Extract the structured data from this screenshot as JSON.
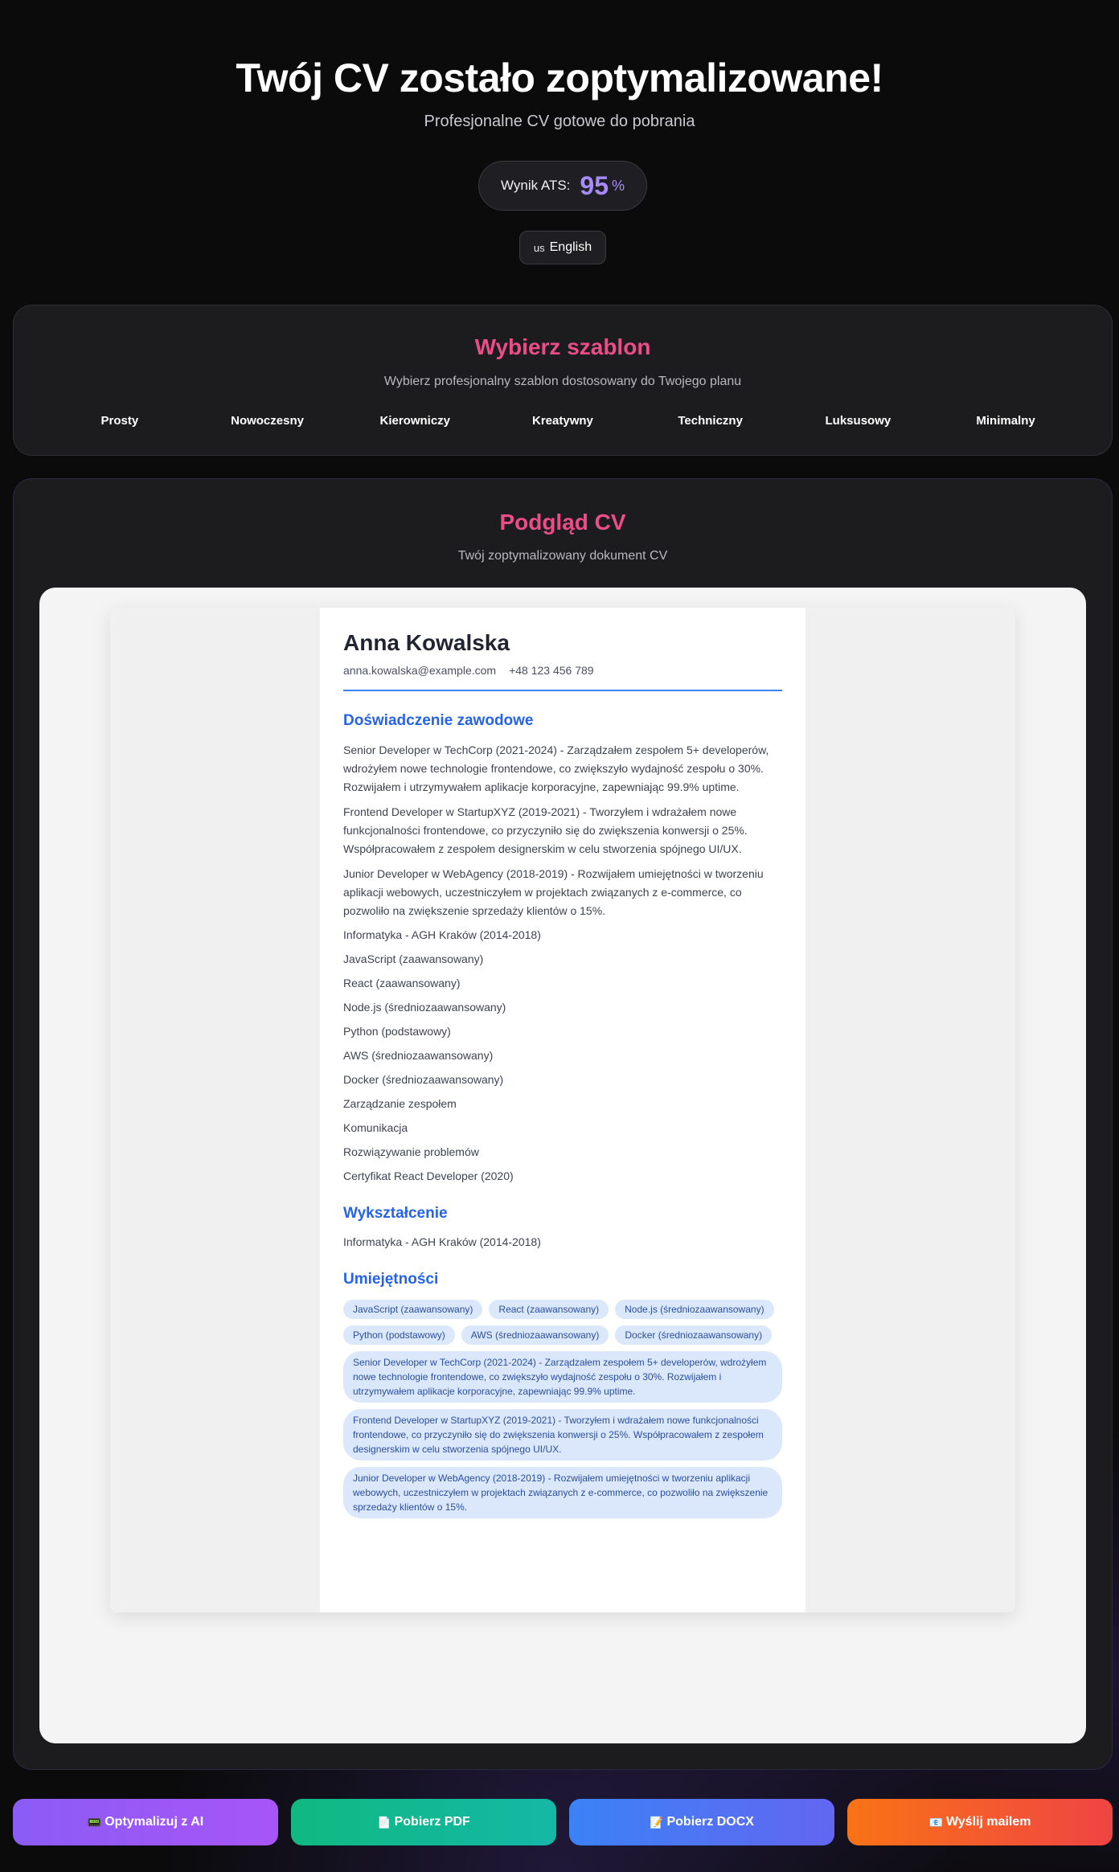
{
  "header": {
    "title": "Twój CV zostało zoptymalizowane!",
    "subtitle": "Profesjonalne CV gotowe do pobrania",
    "ats_label": "Wynik ATS:",
    "ats_score": "95",
    "ats_unit": "%",
    "language_flag": "us",
    "language_label": "English"
  },
  "templates": {
    "title": "Wybierz szablon",
    "subtitle": "Wybierz profesjonalny szablon dostosowany do Twojego planu",
    "items": [
      "Prosty",
      "Nowoczesny",
      "Kierowniczy",
      "Kreatywny",
      "Techniczny",
      "Luksusowy",
      "Minimalny"
    ]
  },
  "preview": {
    "title": "Podgląd CV",
    "subtitle": "Twój zoptymalizowany dokument CV"
  },
  "cv": {
    "name": "Anna Kowalska",
    "email": "anna.kowalska@example.com",
    "phone": "+48 123 456 789",
    "experience_title": "Doświadczenie zawodowe",
    "experience": [
      "Senior Developer w TechCorp (2021-2024) - Zarządzałem zespołem 5+ developerów, wdrożyłem nowe technologie frontendowe, co zwiększyło wydajność zespołu o 30%. Rozwijałem i utrzymywałem aplikacje korporacyjne, zapewniając 99.9% uptime.",
      "Frontend Developer w StartupXYZ (2019-2021) - Tworzyłem i wdrażałem nowe funkcjonalności frontendowe, co przyczyniło się do zwiększenia konwersji o 25%. Współpracowałem z zespołem designerskim w celu stworzenia spójnego UI/UX.",
      "Junior Developer w WebAgency (2018-2019) - Rozwijałem umiejętności w tworzeniu aplikacji webowych, uczestniczyłem w projektach związanych z e-commerce, co pozwoliło na zwiększenie sprzedaży klientów o 15%."
    ],
    "experience_extra": [
      "Informatyka - AGH Kraków (2014-2018)",
      "JavaScript (zaawansowany)",
      "React (zaawansowany)",
      "Node.js (średniozaawansowany)",
      "Python (podstawowy)",
      "AWS (średniozaawansowany)",
      "Docker (średniozaawansowany)",
      "Zarządzanie zespołem",
      "Komunikacja",
      "Rozwiązywanie problemów",
      "Certyfikat React Developer (2020)"
    ],
    "education_title": "Wykształcenie",
    "education": "Informatyka - AGH Kraków (2014-2018)",
    "skills_title": "Umiejętności",
    "skills": [
      "JavaScript (zaawansowany)",
      "React (zaawansowany)",
      "Node.js (średniozaawansowany)",
      "Python (podstawowy)",
      "AWS (średniozaawansowany)",
      "Docker (średniozaawansowany)"
    ],
    "skills_long": [
      "Senior Developer w TechCorp (2021-2024) - Zarządzałem zespołem 5+ developerów, wdrożyłem nowe technologie frontendowe, co zwiększyło wydajność zespołu o 30%. Rozwijałem i utrzymywałem aplikacje korporacyjne, zapewniając 99.9% uptime.",
      "Frontend Developer w StartupXYZ (2019-2021) - Tworzyłem i wdrażałem nowe funkcjonalności frontendowe, co przyczyniło się do zwiększenia konwersji o 25%. Współpracowałem z zespołem designerskim w celu stworzenia spójnego UI/UX.",
      "Junior Developer w WebAgency (2018-2019) - Rozwijałem umiejętności w tworzeniu aplikacji webowych, uczestniczyłem w projektach związanych z e-commerce, co pozwoliło na zwiększenie sprzedaży klientów o 15%."
    ]
  },
  "actions": {
    "optimize_icon": "📟",
    "optimize_label": "Optymalizuj z AI",
    "pdf_icon": "📄",
    "pdf_label": "Pobierz PDF",
    "docx_icon": "📝",
    "docx_label": "Pobierz DOCX",
    "mail_icon": "📧",
    "mail_label": "Wyślij mailem"
  },
  "colors": {
    "accent_pink": "#ec4d86",
    "accent_purple": "#a78bfa",
    "cv_blue": "#2563eb"
  }
}
